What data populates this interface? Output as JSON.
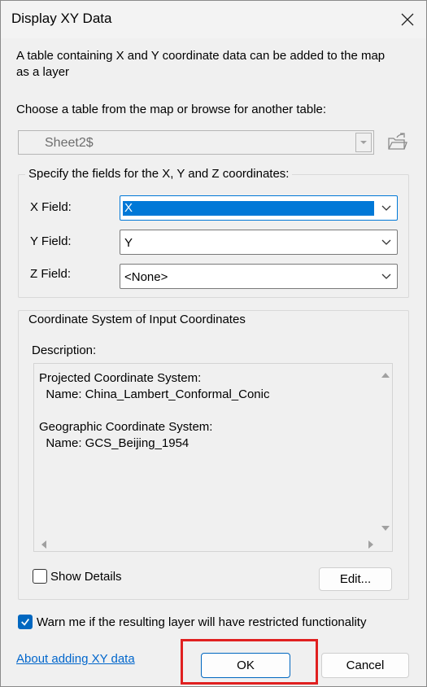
{
  "dialog": {
    "title": "Display XY Data",
    "intro": "A table containing X and Y coordinate data can be added to the map as a layer",
    "choose_label": "Choose a table from the map or browse for another table:",
    "table_value": "Sheet2$"
  },
  "fields_group": {
    "label": "Specify the fields for the X, Y and Z coordinates:",
    "x_label": "X Field:",
    "x_value": "X",
    "y_label": "Y Field:",
    "y_value": "Y",
    "z_label": "Z Field:",
    "z_value": "<None>"
  },
  "coord_group": {
    "label": "Coordinate System of Input Coordinates",
    "description_label": "Description:",
    "description_text": "Projected Coordinate System:\n  Name: China_Lambert_Conformal_Conic\n\nGeographic Coordinate System:\n  Name: GCS_Beijing_1954",
    "show_details_label": "Show Details",
    "show_details_checked": false,
    "edit_label": "Edit..."
  },
  "warn_label": "Warn me if the resulting layer will have restricted functionality",
  "warn_checked": true,
  "about_link": "About adding XY data",
  "ok_label": "OK",
  "cancel_label": "Cancel",
  "colors": {
    "accent": "#0078d7",
    "highlight": "#e02020",
    "link": "#0066cc"
  }
}
